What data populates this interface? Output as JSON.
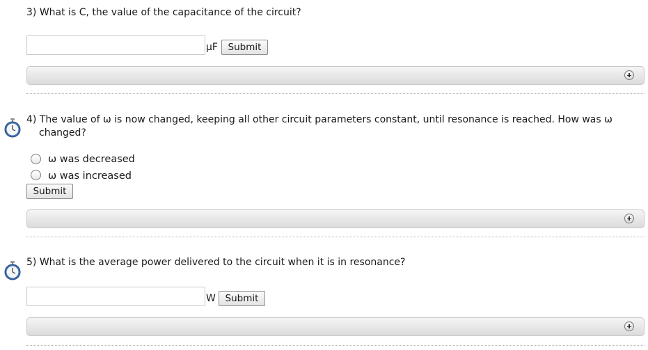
{
  "q3": {
    "text": "3) What is C, the value of the capacitance of the circuit?",
    "input_value": "",
    "unit": "µF",
    "submit_label": "Submit"
  },
  "q4": {
    "number": "4)",
    "line1": "The value of ω is now changed, keeping all other circuit parameters constant, until resonance is reached. How was ω",
    "line2": "changed?",
    "options": [
      {
        "label": "ω was decreased",
        "selected": false
      },
      {
        "label": "ω was increased",
        "selected": false
      }
    ],
    "submit_label": "Submit"
  },
  "q5": {
    "text": "5) What is the average power delivered to the circuit when it is in resonance?",
    "input_value": "",
    "unit": "W",
    "submit_label": "Submit"
  },
  "icons": {
    "timer": "stopwatch-icon",
    "expand": "plus-circle-icon"
  }
}
